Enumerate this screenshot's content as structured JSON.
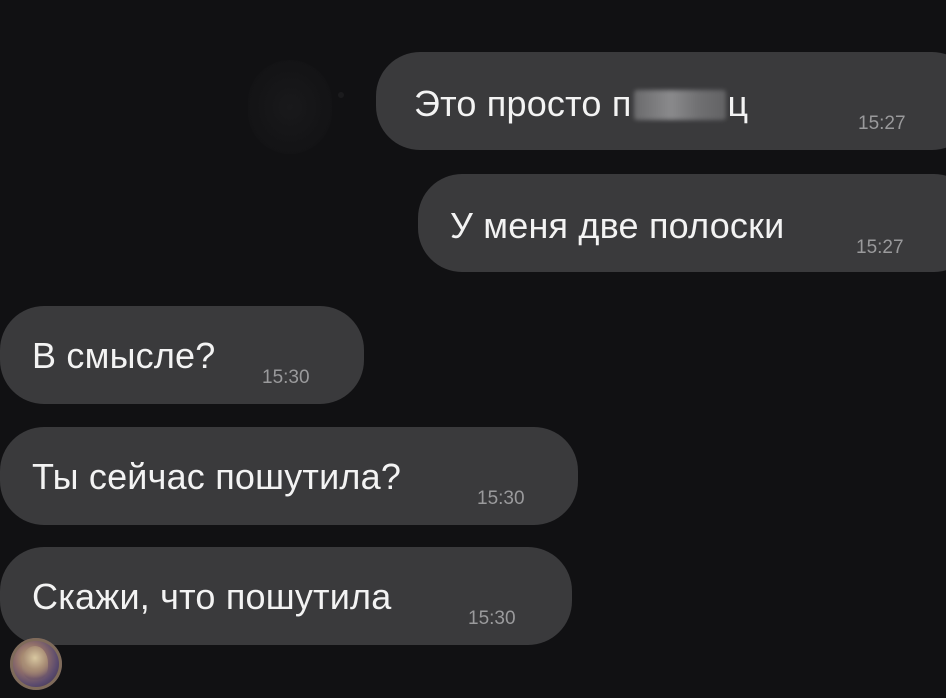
{
  "messages": [
    {
      "direction": "outgoing",
      "text_before": "Это просто п",
      "text_after": "ц",
      "redacted": true,
      "time": "15:27"
    },
    {
      "direction": "outgoing",
      "text": "У меня две полоски",
      "time": "15:27"
    },
    {
      "direction": "incoming",
      "text": "В смысле?",
      "time": "15:30"
    },
    {
      "direction": "incoming",
      "text": "Ты сейчас пошутила?",
      "time": "15:30"
    },
    {
      "direction": "incoming",
      "text": "Скажи, что пошутила",
      "time": "15:30"
    }
  ],
  "colors": {
    "background": "#111113",
    "bubble": "#3a3a3c",
    "text": "#f3f3f3",
    "time": "#9a9a9c"
  }
}
